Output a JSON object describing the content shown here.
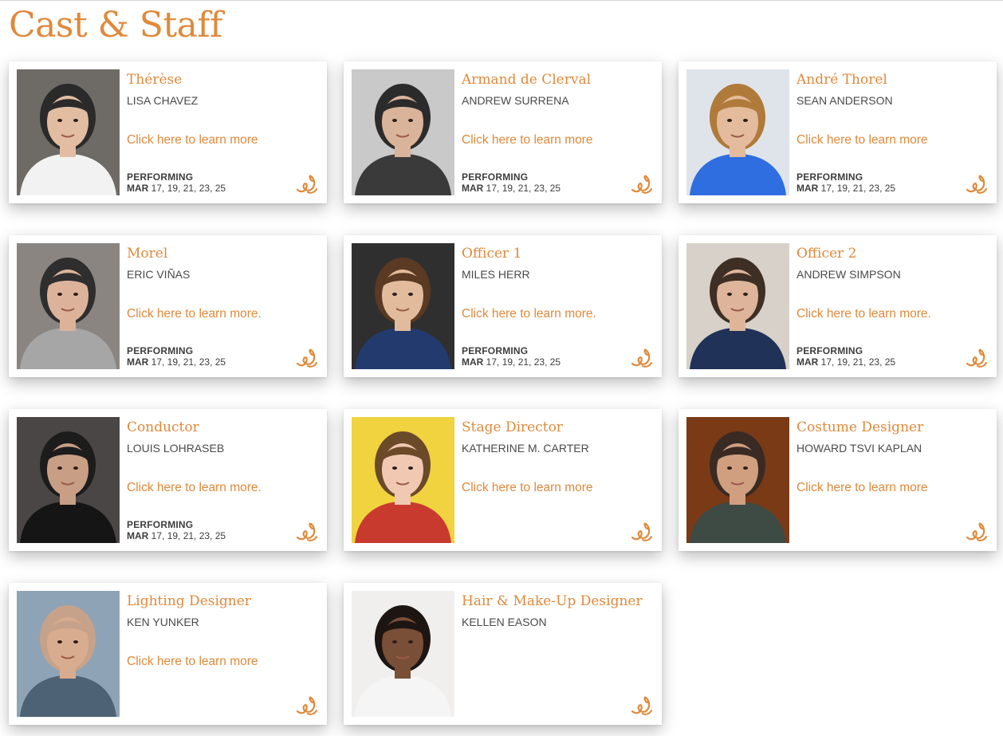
{
  "page": {
    "title": "Cast & Staff"
  },
  "colors": {
    "accent": "#e0893a",
    "text": "#4a4a4a",
    "dark_text": "#3d3d3d"
  },
  "cards": [
    {
      "role": "Thérèse",
      "person": "LISA CHAVEZ",
      "link": "Click here to learn more",
      "perf_label": "PERFORMING",
      "perf_month": "MAR",
      "perf_days": "17, 19, 21, 23, 25",
      "photo": "headshot-photo",
      "icon": "brand-logo-icon"
    },
    {
      "role": "Armand de Clerval",
      "person": "ANDREW SURRENA",
      "link": "Click here to learn more",
      "perf_label": "PERFORMING",
      "perf_month": "MAR",
      "perf_days": "17, 19, 21, 23, 25",
      "photo": "headshot-photo",
      "icon": "brand-logo-icon"
    },
    {
      "role": "André Thorel",
      "person": "SEAN ANDERSON",
      "link": "Click here to learn more",
      "perf_label": "PERFORMING",
      "perf_month": "MAR",
      "perf_days": "17, 19, 21, 23, 25",
      "photo": "headshot-photo",
      "icon": "brand-logo-icon"
    },
    {
      "role": "Morel",
      "person": "ERIC VIÑAS",
      "link": "Click here to learn more.",
      "perf_label": "PERFORMING",
      "perf_month": "MAR",
      "perf_days": "17, 19, 21, 23, 25",
      "photo": "headshot-photo",
      "icon": "brand-logo-icon"
    },
    {
      "role": "Officer 1",
      "person": "MILES HERR",
      "link": "Click here to learn more.",
      "perf_label": "PERFORMING",
      "perf_month": "MAR",
      "perf_days": "17, 19, 21, 23, 25",
      "photo": "headshot-photo",
      "icon": "brand-logo-icon"
    },
    {
      "role": "Officer 2",
      "person": "ANDREW SIMPSON",
      "link": "Click here to learn more.",
      "perf_label": "PERFORMING",
      "perf_month": "MAR",
      "perf_days": "17, 19, 21, 23, 25",
      "photo": "headshot-photo",
      "icon": "brand-logo-icon"
    },
    {
      "role": "Conductor",
      "person": "LOUIS LOHRASEB",
      "link": "Click here to learn more.",
      "perf_label": "PERFORMING",
      "perf_month": "MAR",
      "perf_days": "17, 19, 21, 23, 25",
      "photo": "headshot-photo",
      "icon": "brand-logo-icon"
    },
    {
      "role": "Stage Director",
      "person": "KATHERINE M. CARTER",
      "link": "Click here to learn more",
      "perf_label": "",
      "perf_month": "",
      "perf_days": "",
      "photo": "headshot-photo",
      "icon": "brand-logo-icon"
    },
    {
      "role": "Costume Designer",
      "person": "HOWARD TSVI KAPLAN",
      "link": "Click here to learn more",
      "perf_label": "",
      "perf_month": "",
      "perf_days": "",
      "photo": "headshot-photo",
      "icon": "brand-logo-icon"
    },
    {
      "role": "Lighting Designer",
      "person": "KEN YUNKER",
      "link": "Click here to learn more",
      "perf_label": "",
      "perf_month": "",
      "perf_days": "",
      "photo": "headshot-photo",
      "icon": "brand-logo-icon"
    },
    {
      "role": "Hair & Make-Up Designer",
      "person": "KELLEN EASON",
      "link": "",
      "perf_label": "",
      "perf_month": "",
      "perf_days": "",
      "photo": "headshot-photo",
      "icon": "brand-logo-icon"
    }
  ]
}
